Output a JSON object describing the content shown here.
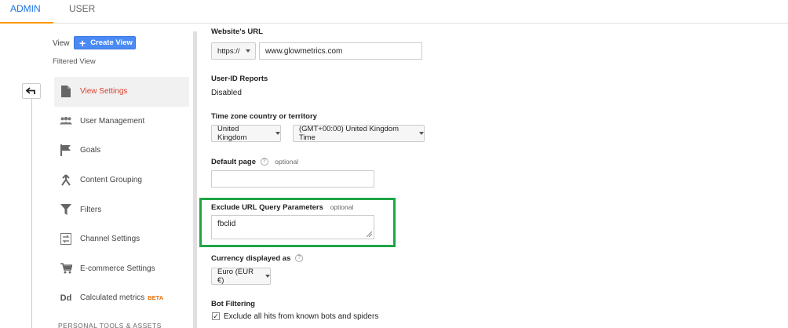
{
  "tabs": [
    {
      "label": "ADMIN",
      "active": true
    },
    {
      "label": "USER",
      "active": false
    }
  ],
  "sidebar": {
    "view_label": "View",
    "create_view_label": "Create View",
    "filtered_view_label": "Filtered View",
    "items": [
      {
        "label": "View Settings",
        "icon": "document-icon",
        "active": true
      },
      {
        "label": "User Management",
        "icon": "users-icon"
      },
      {
        "label": "Goals",
        "icon": "flag-icon"
      },
      {
        "label": "Content Grouping",
        "icon": "merge-icon"
      },
      {
        "label": "Filters",
        "icon": "filter-icon"
      },
      {
        "label": "Channel Settings",
        "icon": "channel-icon"
      },
      {
        "label": "E-commerce Settings",
        "icon": "cart-icon"
      },
      {
        "label": "Calculated metrics",
        "icon": "dd-icon",
        "badge": "BETA"
      }
    ],
    "section_header": "PERSONAL TOOLS & ASSETS"
  },
  "form": {
    "website_url_label": "Website's URL",
    "protocol": "https://",
    "website_url": "www.glowmetrics.com",
    "user_id_label": "User-ID Reports",
    "user_id_value": "Disabled",
    "timezone_label": "Time zone country or territory",
    "country": "United Kingdom",
    "timezone": "(GMT+00:00) United Kingdom Time",
    "default_page_label": "Default page",
    "default_page_optional": "optional",
    "default_page_value": "",
    "exclude_label": "Exclude URL Query Parameters",
    "exclude_optional": "optional",
    "exclude_value": "fbclid",
    "currency_label": "Currency displayed as",
    "currency": "Euro (EUR €)",
    "bot_label": "Bot Filtering",
    "bot_checkbox_label": "Exclude all hits from known bots and spiders",
    "bot_checked": true,
    "help_glyph": "?",
    "check_glyph": "✓"
  },
  "colors": {
    "accent": "#1a73e8",
    "tab_underline": "#ff9800",
    "active_nav": "#d8412f",
    "highlight": "#1fa546",
    "button": "#4a8af4"
  }
}
